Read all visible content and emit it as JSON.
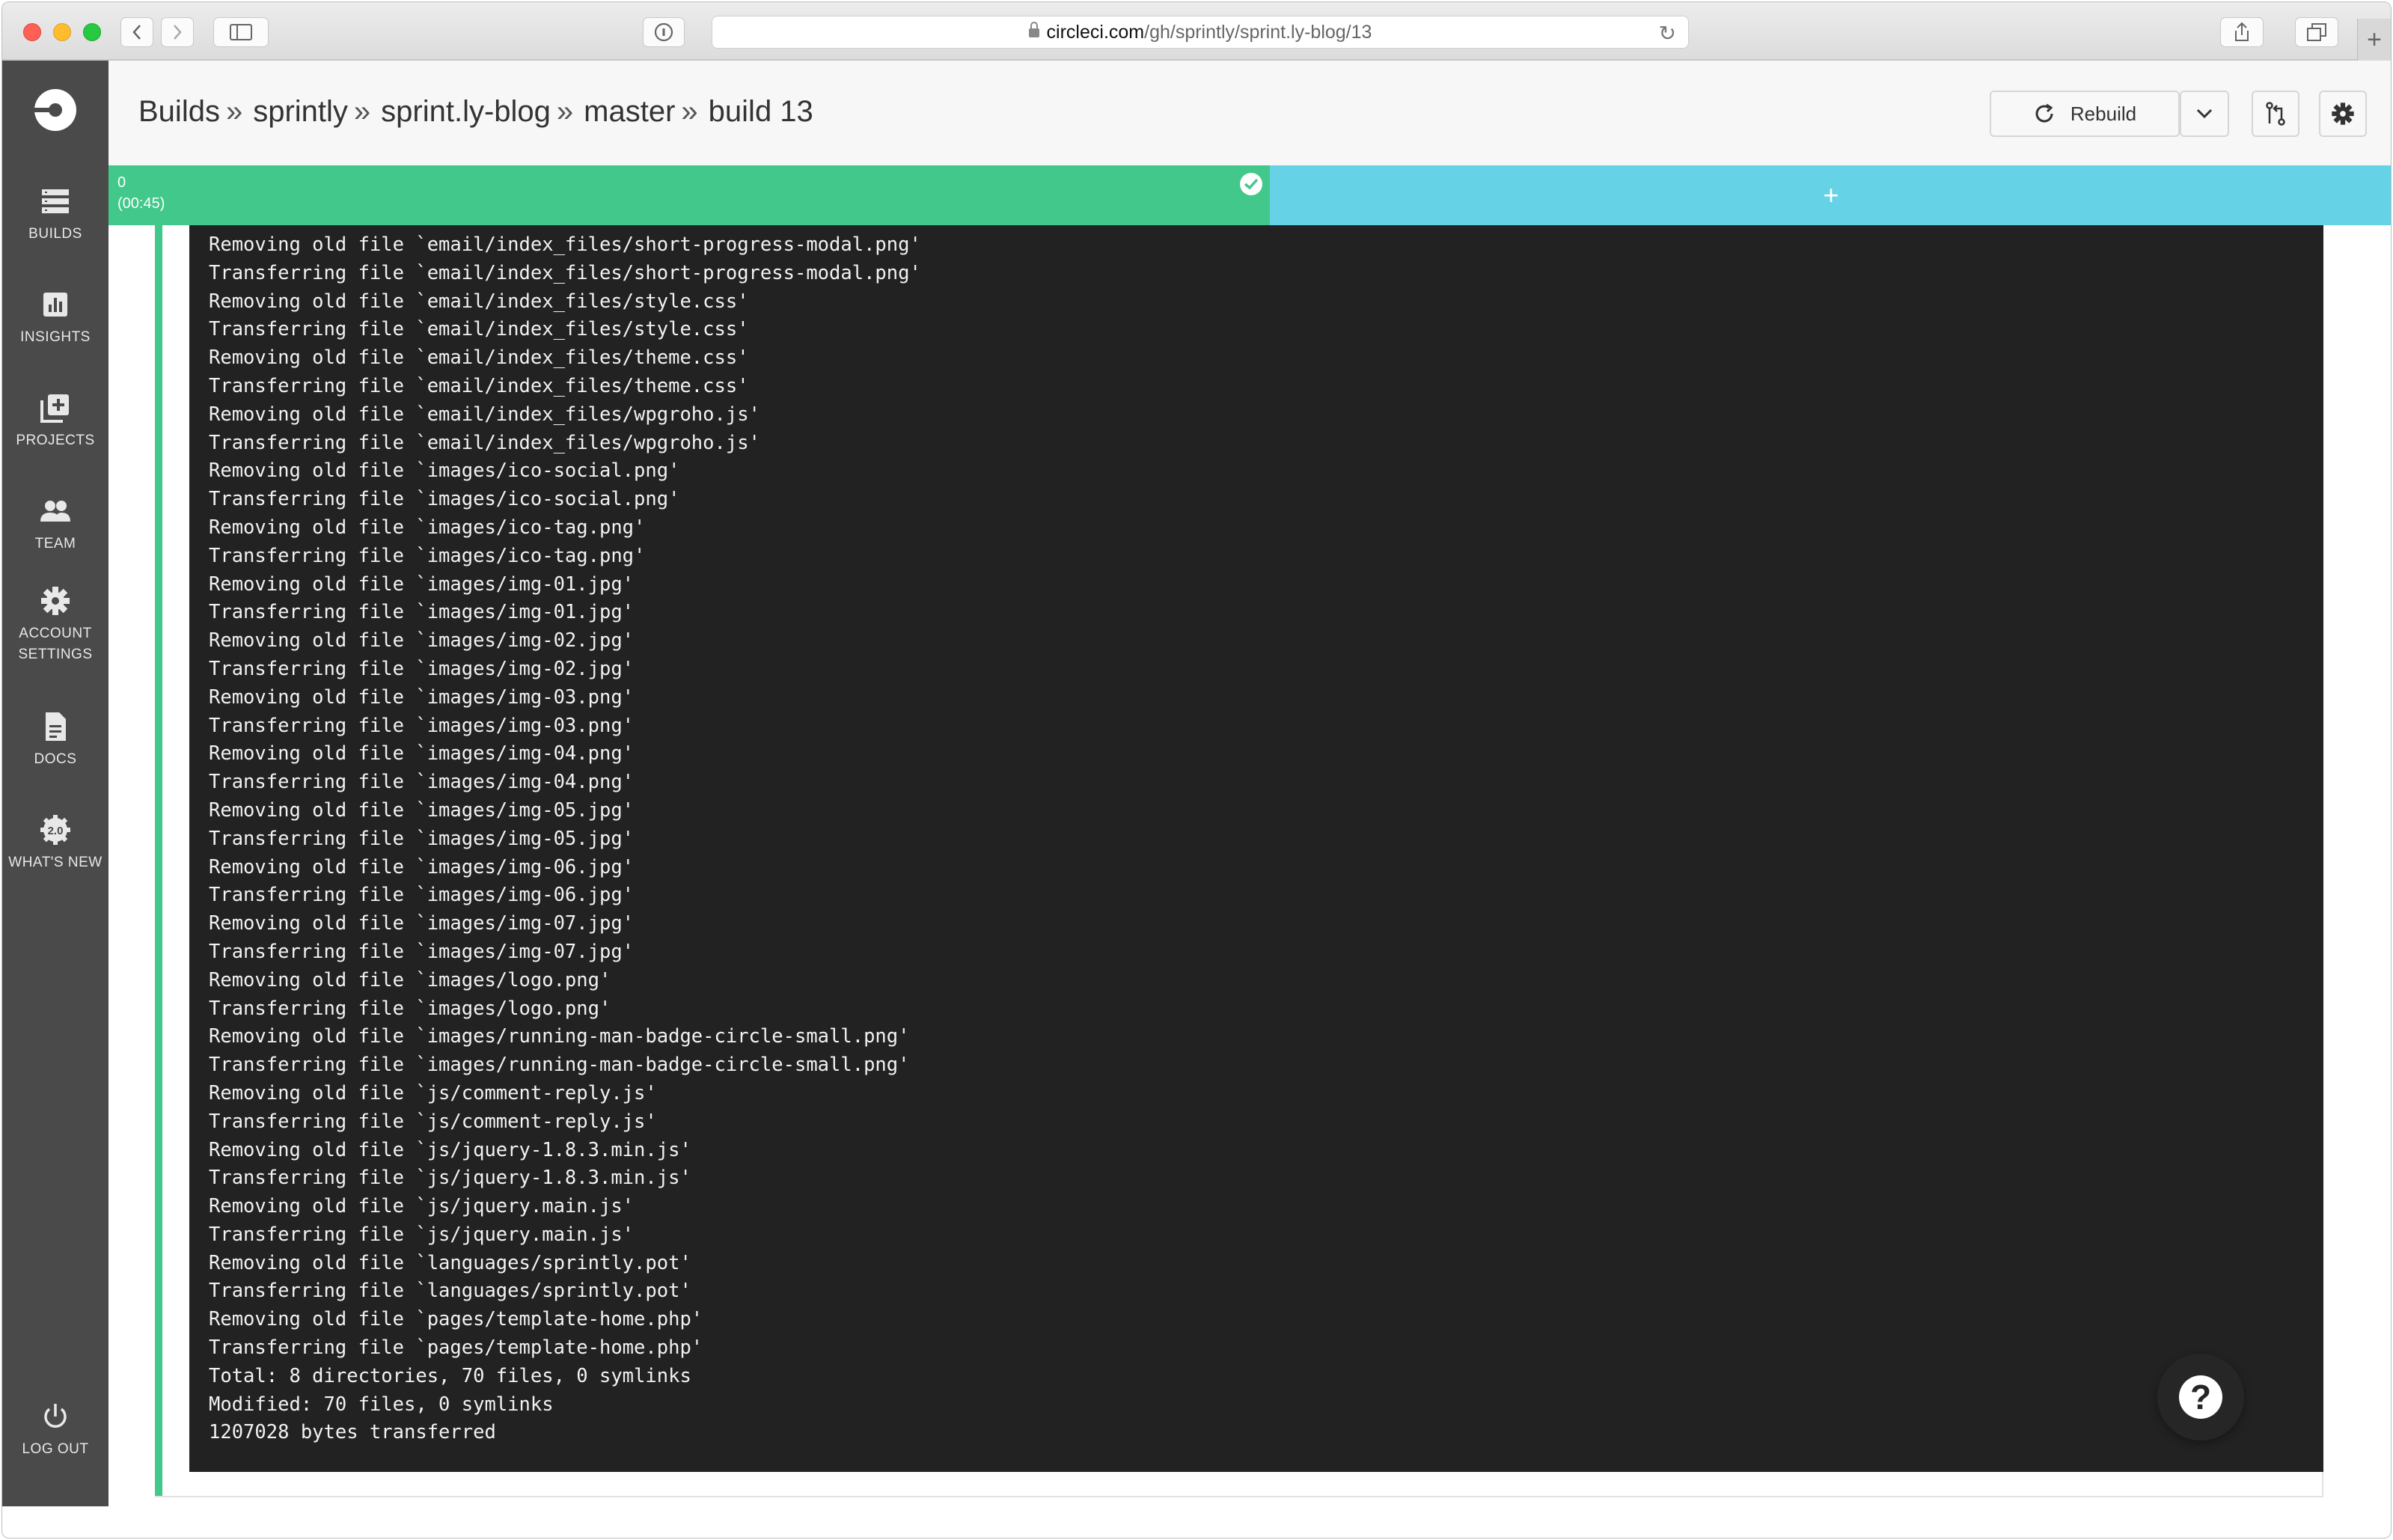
{
  "browser": {
    "url_host": "circleci.com",
    "url_path": "/gh/sprintly/sprint.ly-blog/13"
  },
  "sidebar": {
    "items": [
      {
        "label": "BUILDS",
        "icon": "builds-icon"
      },
      {
        "label": "INSIGHTS",
        "icon": "insights-icon"
      },
      {
        "label": "PROJECTS",
        "icon": "projects-icon"
      },
      {
        "label": "TEAM",
        "icon": "team-icon"
      },
      {
        "label": "ACCOUNT",
        "label2": "SETTINGS",
        "icon": "gear-icon"
      },
      {
        "label": "DOCS",
        "icon": "docs-icon"
      },
      {
        "label": "WHAT'S NEW",
        "icon": "whats-new-icon",
        "badge": "2.0"
      }
    ],
    "logout_label": "LOG OUT"
  },
  "header": {
    "breadcrumb": [
      "Builds",
      "sprintly",
      "sprint.ly-blog",
      "master",
      "build 13"
    ],
    "separator": "»",
    "rebuild_label": "Rebuild"
  },
  "containers": {
    "index": "0",
    "time": "(00:45)",
    "add_label": "+"
  },
  "log_lines": [
    "Removing old file `email/index_files/short-progress-modal.png'",
    "Transferring file `email/index_files/short-progress-modal.png'",
    "Removing old file `email/index_files/style.css'",
    "Transferring file `email/index_files/style.css'",
    "Removing old file `email/index_files/theme.css'",
    "Transferring file `email/index_files/theme.css'",
    "Removing old file `email/index_files/wpgroho.js'",
    "Transferring file `email/index_files/wpgroho.js'",
    "Removing old file `images/ico-social.png'",
    "Transferring file `images/ico-social.png'",
    "Removing old file `images/ico-tag.png'",
    "Transferring file `images/ico-tag.png'",
    "Removing old file `images/img-01.jpg'",
    "Transferring file `images/img-01.jpg'",
    "Removing old file `images/img-02.jpg'",
    "Transferring file `images/img-02.jpg'",
    "Removing old file `images/img-03.png'",
    "Transferring file `images/img-03.png'",
    "Removing old file `images/img-04.png'",
    "Transferring file `images/img-04.png'",
    "Removing old file `images/img-05.jpg'",
    "Transferring file `images/img-05.jpg'",
    "Removing old file `images/img-06.jpg'",
    "Transferring file `images/img-06.jpg'",
    "Removing old file `images/img-07.jpg'",
    "Transferring file `images/img-07.jpg'",
    "Removing old file `images/logo.png'",
    "Transferring file `images/logo.png'",
    "Removing old file `images/running-man-badge-circle-small.png'",
    "Transferring file `images/running-man-badge-circle-small.png'",
    "Removing old file `js/comment-reply.js'",
    "Transferring file `js/comment-reply.js'",
    "Removing old file `js/jquery-1.8.3.min.js'",
    "Transferring file `js/jquery-1.8.3.min.js'",
    "Removing old file `js/jquery.main.js'",
    "Transferring file `js/jquery.main.js'",
    "Removing old file `languages/sprintly.pot'",
    "Transferring file `languages/sprintly.pot'",
    "Removing old file `pages/template-home.php'",
    "Transferring file `pages/template-home.php'",
    "Total: 8 directories, 70 files, 0 symlinks",
    "Modified: 70 files, 0 symlinks",
    "1207028 bytes transferred"
  ],
  "colors": {
    "sidebar": "#4a4a4a",
    "success_green": "#42c88a",
    "add_container_blue": "#65d2e6",
    "terminal_bg": "#222222"
  }
}
